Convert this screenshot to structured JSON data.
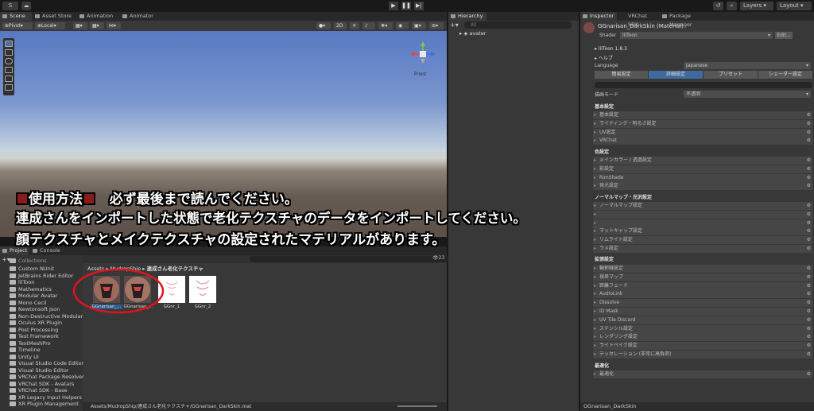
{
  "toolbar": {
    "account": "S",
    "layers": "Layers",
    "layout": "Layout"
  },
  "scene_tabs": [
    "Scene",
    "Asset Store",
    "Animation",
    "Animator"
  ],
  "scene_toolbar": {
    "pivot": "Pivot",
    "local": "Local",
    "mode_2d": "2D"
  },
  "gizmo": {
    "front_label": "Front"
  },
  "overlay": {
    "line1_title": "使用方法",
    "line1_rest": "必ず最後まで読んでください。",
    "line2": "連成さんをインポートした状態で老化テクスチャのデータをインポートしてください。",
    "line3": "顔テクスチャとメイクテクスチャの設定されたマテリアルがあります。"
  },
  "project": {
    "tab": "Project",
    "console_tab": "Console",
    "search_count": "23",
    "breadcrumb": [
      "Assets",
      "MudropShip",
      "連成さん老化テクスチャ"
    ],
    "tree": [
      "Custom NUnit",
      "JetBrains Rider Editor",
      "lilToon",
      "Mathematics",
      "Modular Avatar",
      "Mono Cecil",
      "Newtonsoft Json",
      "Non-Destructive Modular",
      "Oculus XR Plugin",
      "Post Processing",
      "Test Framework",
      "TextMeshPro",
      "Timeline",
      "Unity UI",
      "Visual Studio Code Editor",
      "Visual Studio Editor",
      "VRChat Package Resolver",
      "VRChat SDK - Avatars",
      "VRChat SDK - Base",
      "XR Legacy Input Helpers",
      "XR Plugin Management"
    ],
    "tree_top_partial": "Collections",
    "assets": [
      {
        "label": "GGnarisan_...",
        "kind": "material"
      },
      {
        "label": "GGnarisan_...",
        "kind": "material"
      },
      {
        "label": "GGnr_1",
        "kind": "texture"
      },
      {
        "label": "GGnr_2",
        "kind": "texture"
      }
    ],
    "status_path": "Assets/MudropShip/連成さん老化テクスチャ/GGnarisan_DarkSkin.mat"
  },
  "hierarchy": {
    "tab": "Hierarchy",
    "search_placeholder": "All",
    "root": "avater"
  },
  "inspector": {
    "tabs": [
      "Inspector",
      "VRChat SDK",
      "Package Manager"
    ],
    "title": "GGnarisan_DarkSkin (Material)",
    "shader_label": "Shader",
    "shader_value": "lilToon",
    "edit_button": "Edit...",
    "version": "lilToon 1.8.3",
    "help": "ヘルプ",
    "language_label": "Language",
    "language_value": "Japanese",
    "mode_tabs": [
      "簡易設定",
      "詳細設定",
      "プリセット",
      "シェーダー設定"
    ],
    "render_mode_label": "描画モード",
    "render_mode_value": "不透明",
    "groups": [
      {
        "title": "基本設定",
        "items": [
          "基本設定",
          "ライティング・明るさ設定",
          "UV設定",
          "VRChat"
        ]
      },
      {
        "title": "色設定",
        "items": [
          "メインカラー / 透過設定",
          "影設定",
          "RimShade",
          "発光設定"
        ]
      },
      {
        "title": "ノーマルマップ・光沢設定",
        "items": [
          "ノーマルマップ設定",
          "",
          "",
          "マットキャップ設定",
          "リムライト設定",
          "ラメ設定"
        ]
      },
      {
        "title": "拡張設定",
        "items": [
          "輪郭線設定",
          "視差マップ",
          "距離フェード",
          "AudioLink",
          "Dissolve",
          "ID Mask",
          "UV Tile Discard",
          "ステンシル設定",
          "レンダリング設定",
          "ライトベイク設定",
          "テッセレーション (非常に高負荷)"
        ]
      },
      {
        "title": "最適化",
        "items": [
          "最適化"
        ]
      }
    ],
    "footer": "GGnarisan_DarkSkin"
  }
}
